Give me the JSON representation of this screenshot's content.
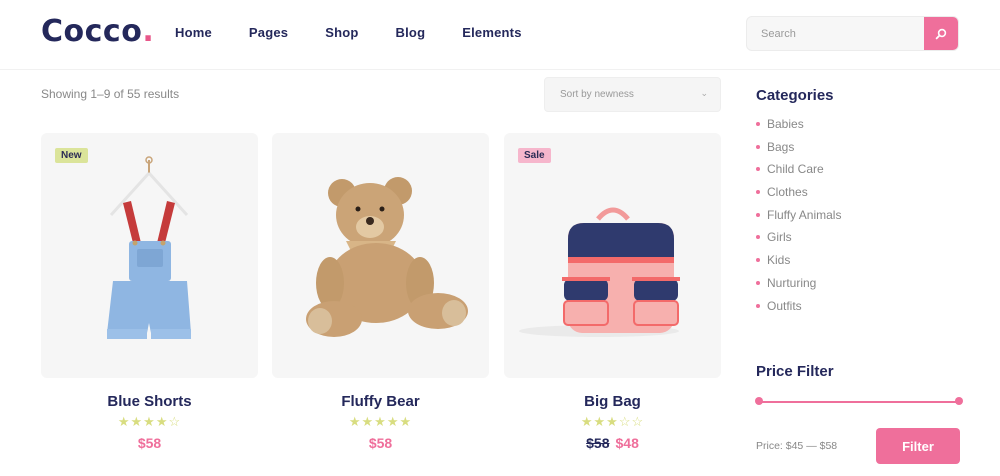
{
  "header": {
    "logo_text": "Cocco",
    "logo_dot": ".",
    "nav": [
      "Home",
      "Pages",
      "Shop",
      "Blog",
      "Elements"
    ],
    "search": {
      "placeholder": "Search",
      "icon": "search-icon"
    }
  },
  "toolbar": {
    "result_count": "Showing 1–9 of 55 results",
    "sort": {
      "selected": "Sort by newness",
      "icon": "chevron-down-icon"
    }
  },
  "products": [
    {
      "badge": "New",
      "name": "Blue Shorts",
      "rating": 4,
      "max_rating": 5,
      "price": "$58",
      "old_price": ""
    },
    {
      "badge": "",
      "name": "Fluffy Bear",
      "rating": 5,
      "max_rating": 5,
      "price": "$58",
      "old_price": ""
    },
    {
      "badge": "Sale",
      "name": "Big Bag",
      "rating": 3,
      "max_rating": 5,
      "price": "$48",
      "old_price": "$58"
    }
  ],
  "sidebar": {
    "categories_title": "Categories",
    "categories": [
      "Babies",
      "Bags",
      "Child Care",
      "Clothes",
      "Fluffy Animals",
      "Girls",
      "Kids",
      "Nurturing",
      "Outfits"
    ],
    "price_filter_title": "Price Filter",
    "price_range_text": "Price: $45 — $58",
    "filter_button": "Filter"
  },
  "colors": {
    "accent": "#ef6f9b",
    "navy": "#24285b",
    "new_badge": "#dbe49a",
    "sale_badge": "#f6b6cc",
    "star": "#d8dd80"
  }
}
